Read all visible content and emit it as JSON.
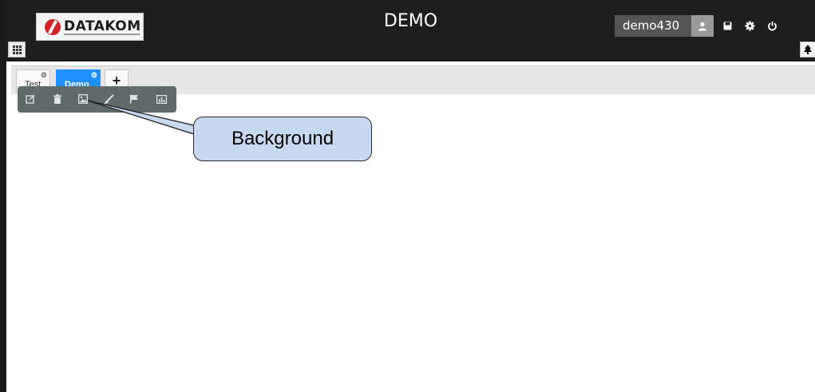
{
  "header": {
    "logo_text": "DATAKOM",
    "title": "DEMO",
    "username": "demo430",
    "icons": [
      "user-icon",
      "save-icon",
      "gear-icon",
      "power-icon"
    ]
  },
  "tabs": [
    {
      "label": "Test",
      "active": false
    },
    {
      "label": "Demo",
      "active": true
    }
  ],
  "add_tab_label": "+",
  "toolbar": {
    "icons": [
      "edit-icon",
      "trash-icon",
      "background-image-icon",
      "brush-icon",
      "flag-icon",
      "chart-icon"
    ]
  },
  "callout": {
    "text": "Background"
  },
  "colors": {
    "header_bg": "#1e1e1e",
    "active_tab": "#1e90ff",
    "toolbar_bg": "#5f6b6b",
    "callout_bg": "#c6d9f1",
    "logo_red": "#d2232a"
  }
}
